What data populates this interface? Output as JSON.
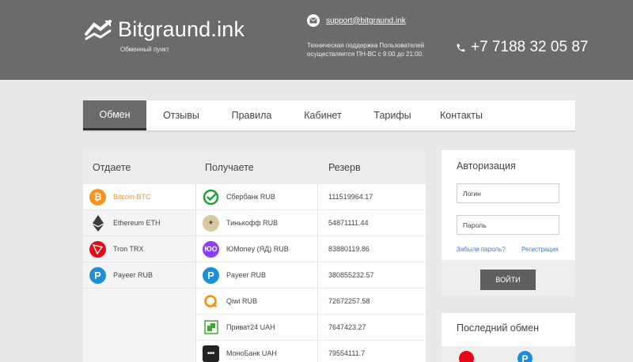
{
  "header": {
    "brand": "Bitgraund.ink",
    "tagline": "Обменный пункт",
    "email": "support@bitgraund.ink",
    "support_text": "Техническая поддержка Пользователей осуществляется ПН-ВС с 9:00 до 21:00.",
    "phone": "+7 7188 32 05 87",
    "bg_color": "#6b6b6b"
  },
  "nav": {
    "items": [
      {
        "label": "Обмен",
        "active": true
      },
      {
        "label": "Отзывы"
      },
      {
        "label": "Правила"
      },
      {
        "label": "Кабинет"
      },
      {
        "label": "Тарифы"
      },
      {
        "label": "Контакты"
      }
    ]
  },
  "exchange": {
    "col_give": "Отдаете",
    "col_get": "Получаете",
    "col_reserve": "Резерв",
    "give": [
      {
        "label": "Bitcoin BTC",
        "icon": "bitcoin-icon",
        "color": "#f7931a",
        "active": true
      },
      {
        "label": "Ethereum ETH",
        "icon": "ethereum-icon",
        "color": "#3c3c3d"
      },
      {
        "label": "Tron TRX",
        "icon": "tron-icon",
        "color": "#e50915"
      },
      {
        "label": "Payeer RUB",
        "icon": "payeer-icon",
        "color": "#1c8fd8"
      }
    ],
    "get": [
      {
        "label": "Сбербанк RUB",
        "reserve": "111519964.17",
        "icon": "sberbank-icon",
        "color": "#21a038"
      },
      {
        "label": "Тинькофф RUB",
        "reserve": "54871111.44",
        "icon": "tinkoff-icon",
        "color": "#c9b38a"
      },
      {
        "label": "ЮMoney (ЯД) RUB",
        "reserve": "83880119.86",
        "icon": "yoomoney-icon",
        "color": "#8b3ffd"
      },
      {
        "label": "Payeer RUB",
        "reserve": "380855232.57",
        "icon": "payeer-icon",
        "color": "#1c8fd8"
      },
      {
        "label": "Qiwi RUB",
        "reserve": "72672257.58",
        "icon": "qiwi-icon",
        "color": "#ff8c00"
      },
      {
        "label": "Приват24 UAH",
        "reserve": "7647423.27",
        "icon": "privat24-icon",
        "color": "#3fa535"
      },
      {
        "label": "МоноБанк UAH",
        "reserve": "79554111.7",
        "icon": "monobank-icon",
        "color": "#222222"
      }
    ]
  },
  "auth": {
    "title": "Авторизация",
    "login_placeholder": "Логин",
    "password_placeholder": "Пароль",
    "forgot": "Забыли пароль?",
    "register": "Регистрация",
    "submit": "ВОЙТИ",
    "link_color": "#3a7bd5"
  },
  "last_exchange": {
    "title": "Последний обмен",
    "icons": [
      "tron-icon",
      "payeer-icon"
    ]
  }
}
